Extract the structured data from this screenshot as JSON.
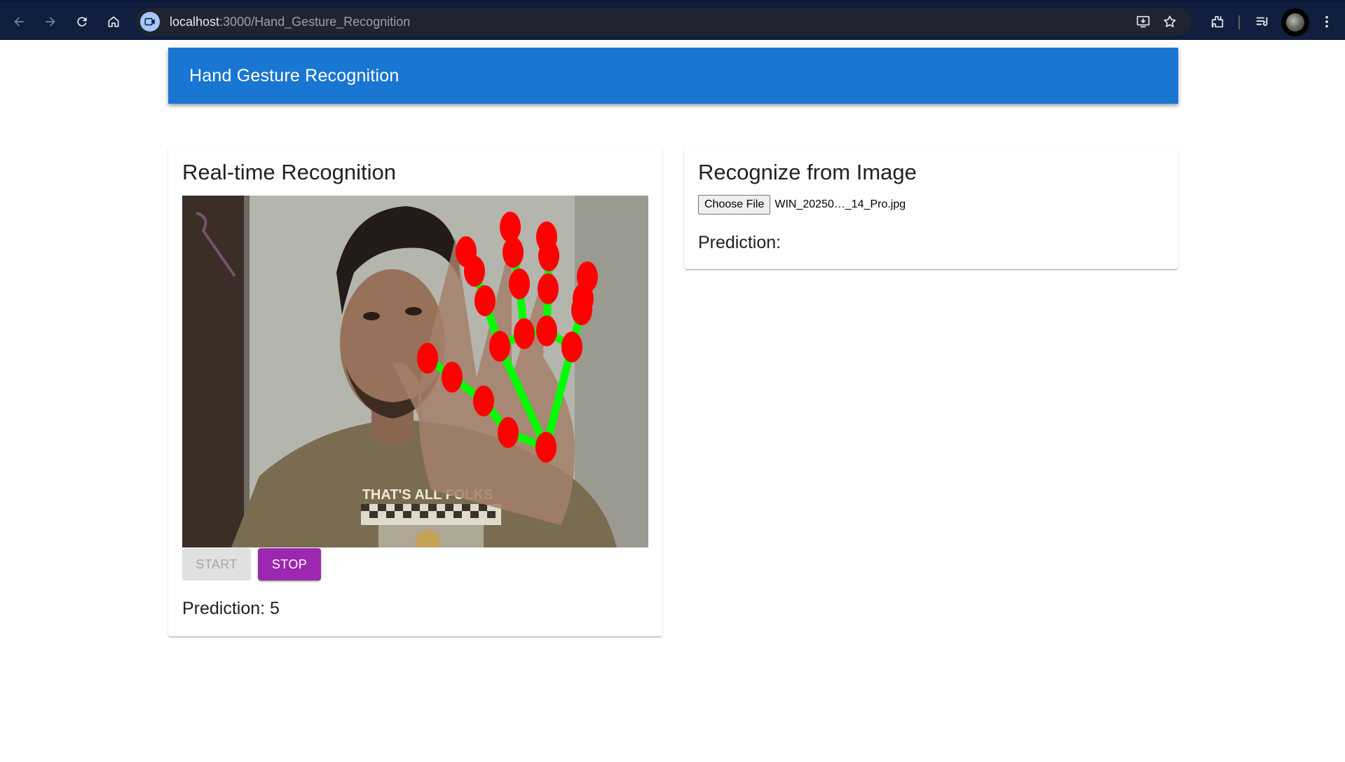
{
  "browser": {
    "url_host": "localhost",
    "url_path": ":3000/Hand_Gesture_Recognition"
  },
  "app": {
    "title": "Hand Gesture Recognition",
    "accent_color": "#1976d2"
  },
  "realtime": {
    "title": "Real-time Recognition",
    "start_label": "START",
    "start_disabled": true,
    "stop_label": "STOP",
    "stop_color": "#9c27b0",
    "prediction_label": "Prediction: 5",
    "shirt_text": "THAT'S ALL FOLKS",
    "landmark_color": "#ff0000",
    "connection_color": "#00ff00"
  },
  "image_upload": {
    "title": "Recognize from Image",
    "choose_file_label": "Choose File",
    "file_name": "WIN_20250…_14_Pro.jpg",
    "prediction_label": "Prediction:"
  }
}
